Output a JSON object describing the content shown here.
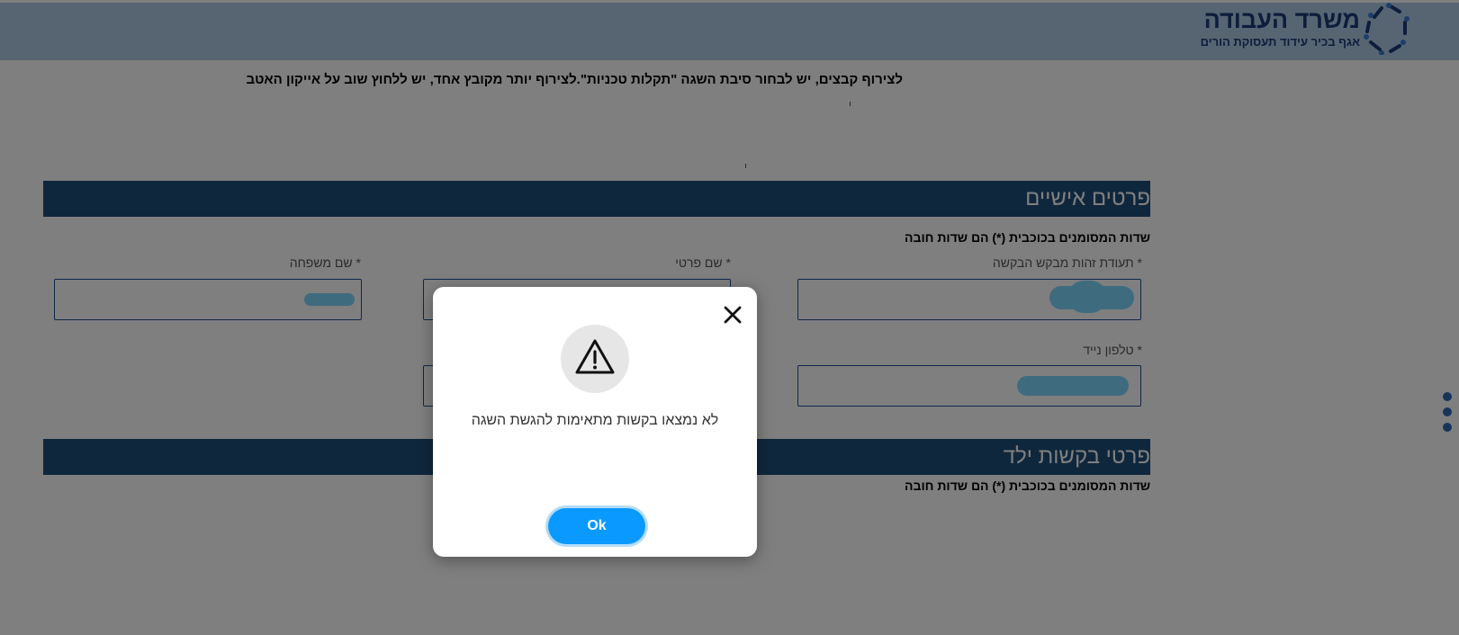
{
  "header": {
    "logo_title": "משרד העבודה",
    "logo_subtitle": "אגף בכיר עידוד תעסוקת הורים"
  },
  "notice": "לצירוף קבצים, יש לבחור סיבת השגה \"תקלות טכניות\".לצירוף יותר מקובץ אחד, יש ללחוץ שוב על אייקון האטב",
  "personal_section": {
    "title": "פרטים אישיים",
    "required_note": "שדות המסומנים בכוכבית (*) הם שדות חובה",
    "fields": {
      "id_label": "* תעודת זהות מבקש הבקשה",
      "first_name_label": "* שם פרטי",
      "last_name_label": "* שם משפחה",
      "phone_label": "* טלפון נייד"
    }
  },
  "child_section": {
    "title": "פרטי בקשות ילד",
    "required_note": "שדות המסומנים בכוכבית (*) הם שדות חובה"
  },
  "modal": {
    "message": "לא נמצאו בקשות מתאימות להגשת השגה",
    "ok_label": "Ok",
    "icon": "warning-triangle-icon",
    "close_icon": "close-icon"
  },
  "colors": {
    "header_bg": "#aecbe6",
    "section_bar": "#1f4e79",
    "brand": "#1d3a78",
    "ok_button": "#0a99ff",
    "redaction": "#7ed6ff"
  }
}
